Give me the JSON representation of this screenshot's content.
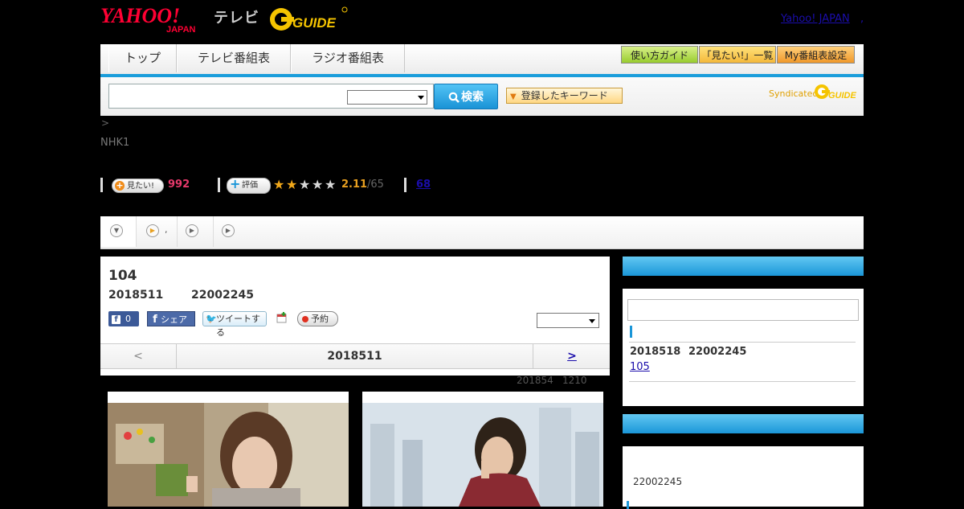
{
  "header": {
    "tv_label": "テレビ",
    "yahoo_link": "Yahoo! JAPAN",
    "yahoo_link_sep": ","
  },
  "nav": {
    "tabs": [
      "トップ",
      "テレビ番組表",
      "ラジオ番組表"
    ],
    "buttons": [
      "使い方ガイド",
      "「見たい!」一覧",
      "My番組表設定"
    ]
  },
  "search": {
    "value": "",
    "button_label": "検索",
    "keyword_button": "登録したキーワード",
    "syndicated": "Syndicated"
  },
  "breadcrumb": ">",
  "channel": "NHK1",
  "stats": {
    "mitai_label": "見たい!",
    "mitai_count": "992",
    "rating_label": "評価",
    "rating_value": 2.11,
    "rating_score": "2.11",
    "rating_count": "/65",
    "review_count": "68"
  },
  "subtabs": {
    "second_label": ","
  },
  "program": {
    "episode": "104",
    "date": "2018511",
    "time": "22002245",
    "fb_like_count": "0",
    "fb_share": "シェア",
    "tweet": "ツイートする",
    "reserve": "予約",
    "nav_prev": "<",
    "nav_center": "2018511",
    "nav_next": ">",
    "updated_date": "201854",
    "updated_time": "1210"
  },
  "sidebar": {
    "next_date": "2018518",
    "next_time": "22002245",
    "next_link": "105",
    "box2_time": "22002245"
  },
  "colors": {
    "accent": "#1a96d8",
    "mitai": "#e6396b",
    "rating": "#e8a020",
    "link": "#1a0dab"
  }
}
